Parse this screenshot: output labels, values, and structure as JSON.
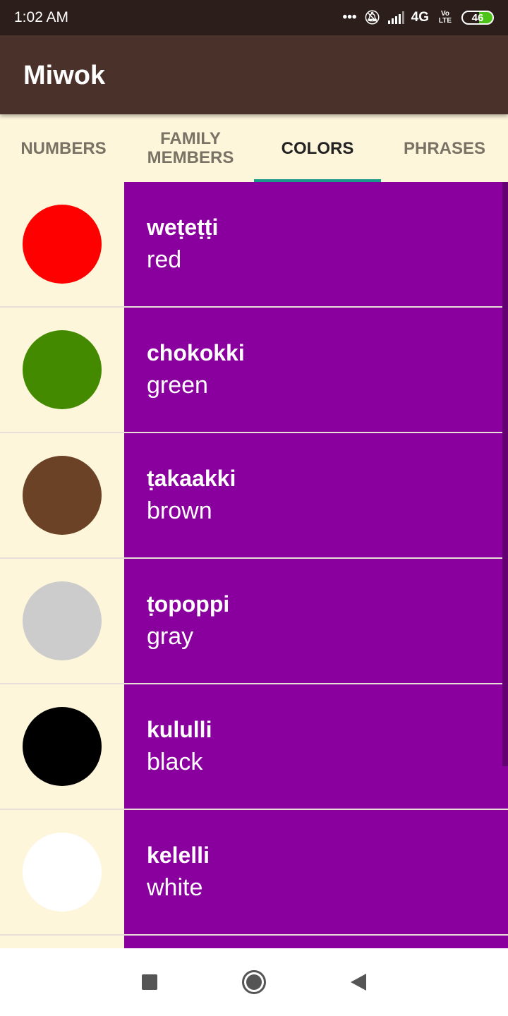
{
  "status": {
    "time": "1:02 AM",
    "network": "4G",
    "volte": "Vo LTE",
    "battery": "46"
  },
  "app": {
    "title": "Miwok"
  },
  "tabs": [
    "NUMBERS",
    "FAMILY MEMBERS",
    "COLORS",
    "PHRASES"
  ],
  "active_tab": "COLORS",
  "colors": {
    "item_bg": "#8a009e",
    "image_bg": "#fef6db"
  },
  "items": [
    {
      "miwok": "weṭeṭṭi",
      "english": "red",
      "swatch": "#ff0000"
    },
    {
      "miwok": "chokokki",
      "english": "green",
      "swatch": "#438a00"
    },
    {
      "miwok": "ṭakaakki",
      "english": "brown",
      "swatch": "#6b4226"
    },
    {
      "miwok": "ṭopoppi",
      "english": "gray",
      "swatch": "#cccccc"
    },
    {
      "miwok": "kululli",
      "english": "black",
      "swatch": "#000000"
    },
    {
      "miwok": "kelelli",
      "english": "white",
      "swatch": "#ffffff"
    }
  ]
}
